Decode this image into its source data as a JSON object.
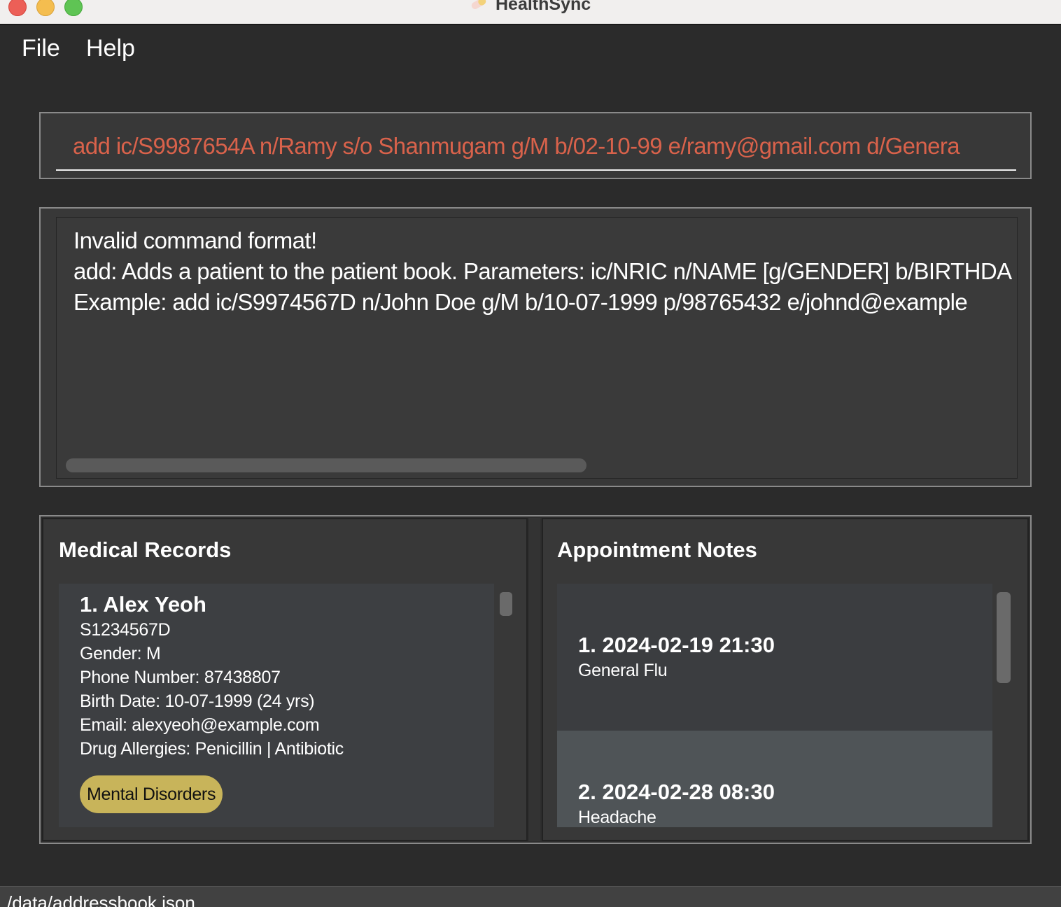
{
  "window": {
    "title": "HealthSync",
    "icon": "pill-icon"
  },
  "menu": {
    "file_label": "File",
    "help_label": "Help"
  },
  "command": {
    "value": "add ic/S9987654A n/Ramy s/o Shanmugam g/M b/02-10-99 e/ramy@gmail.com d/Genera"
  },
  "result": {
    "lines": [
      "Invalid command format!",
      "add: Adds a patient to the patient book. Parameters: ic/NRIC n/NAME [g/GENDER] b/BIRTHDA",
      "Example: add ic/S9974567D n/John Doe g/M b/10-07-1999 p/98765432 e/johnd@example"
    ]
  },
  "medical_records": {
    "title": "Medical Records",
    "patients": [
      {
        "heading": "1.  Alex Yeoh",
        "nric": "S1234567D",
        "gender": "Gender: M",
        "phone": "Phone Number: 87438807",
        "birth": "Birth Date: 10-07-1999 (24 yrs)",
        "email": "Email: alexyeoh@example.com",
        "allergies": "Drug Allergies: Penicillin | Antibiotic",
        "tag": "Mental Disorders",
        "tag_color": "#c8b45a"
      }
    ]
  },
  "appointment_notes": {
    "title": "Appointment Notes",
    "notes": [
      {
        "heading": "1.  2024-02-19 21:30",
        "description": "General Flu"
      },
      {
        "heading": "2.  2024-02-28 08:30",
        "description": "Headache"
      }
    ]
  },
  "status": {
    "path": "/data/addressbook.json"
  }
}
